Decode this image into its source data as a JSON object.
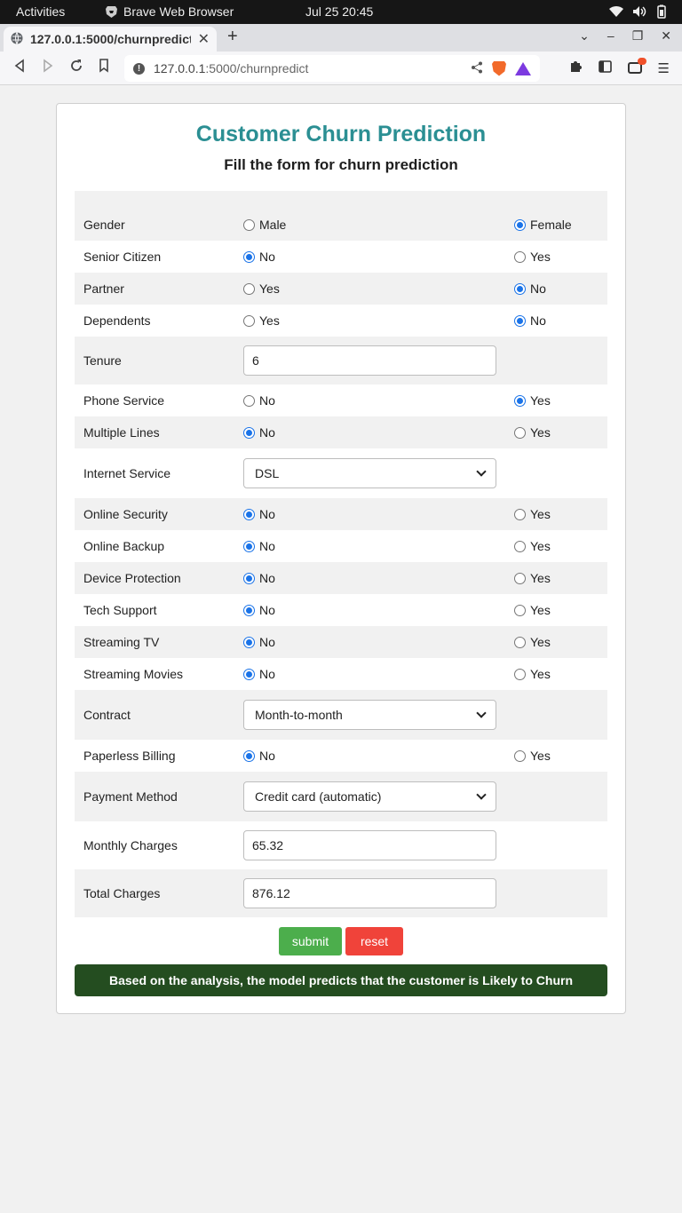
{
  "os": {
    "activities": "Activities",
    "app_name": "Brave Web Browser",
    "clock": "Jul 25  20:45"
  },
  "browser": {
    "tab_title": "127.0.0.1:5000/churnpredict",
    "url_host": "127.0.0.1",
    "url_rest": ":5000/churnpredict"
  },
  "form": {
    "title": "Customer Churn Prediction",
    "subtitle": "Fill the form for churn prediction",
    "rows": {
      "gender": {
        "label": "Gender",
        "opt_a": "Male",
        "opt_b": "Female",
        "selected": "b"
      },
      "senior_citizen": {
        "label": "Senior Citizen",
        "opt_a": "No",
        "opt_b": "Yes",
        "selected": "a"
      },
      "partner": {
        "label": "Partner",
        "opt_a": "Yes",
        "opt_b": "No",
        "selected": "b"
      },
      "dependents": {
        "label": "Dependents",
        "opt_a": "Yes",
        "opt_b": "No",
        "selected": "b"
      },
      "tenure": {
        "label": "Tenure",
        "value": "6"
      },
      "phone_service": {
        "label": "Phone Service",
        "opt_a": "No",
        "opt_b": "Yes",
        "selected": "b"
      },
      "multiple_lines": {
        "label": "Multiple Lines",
        "opt_a": "No",
        "opt_b": "Yes",
        "selected": "a"
      },
      "internet_service": {
        "label": "Internet Service",
        "value": "DSL"
      },
      "online_security": {
        "label": "Online Security",
        "opt_a": "No",
        "opt_b": "Yes",
        "selected": "a"
      },
      "online_backup": {
        "label": "Online Backup",
        "opt_a": "No",
        "opt_b": "Yes",
        "selected": "a"
      },
      "device_protection": {
        "label": "Device Protection",
        "opt_a": "No",
        "opt_b": "Yes",
        "selected": "a"
      },
      "tech_support": {
        "label": "Tech Support",
        "opt_a": "No",
        "opt_b": "Yes",
        "selected": "a"
      },
      "streaming_tv": {
        "label": "Streaming TV",
        "opt_a": "No",
        "opt_b": "Yes",
        "selected": "a"
      },
      "streaming_movies": {
        "label": "Streaming Movies",
        "opt_a": "No",
        "opt_b": "Yes",
        "selected": "a"
      },
      "contract": {
        "label": "Contract",
        "value": "Month-to-month"
      },
      "paperless_billing": {
        "label": "Paperless Billing",
        "opt_a": "No",
        "opt_b": "Yes",
        "selected": "a"
      },
      "payment_method": {
        "label": "Payment Method",
        "value": "Credit card (automatic)"
      },
      "monthly_charges": {
        "label": "Monthly Charges",
        "value": "65.32"
      },
      "total_charges": {
        "label": "Total Charges",
        "value": "876.12"
      }
    },
    "submit_label": "submit",
    "reset_label": "reset",
    "result": "Based on the analysis, the model predicts that the customer is Likely to Churn"
  },
  "colors": {
    "title": "#2b8f93",
    "submit": "#4cae4c",
    "reset": "#f0433a",
    "result_bg": "#244d20",
    "radio_checked": "#1a73e8"
  }
}
